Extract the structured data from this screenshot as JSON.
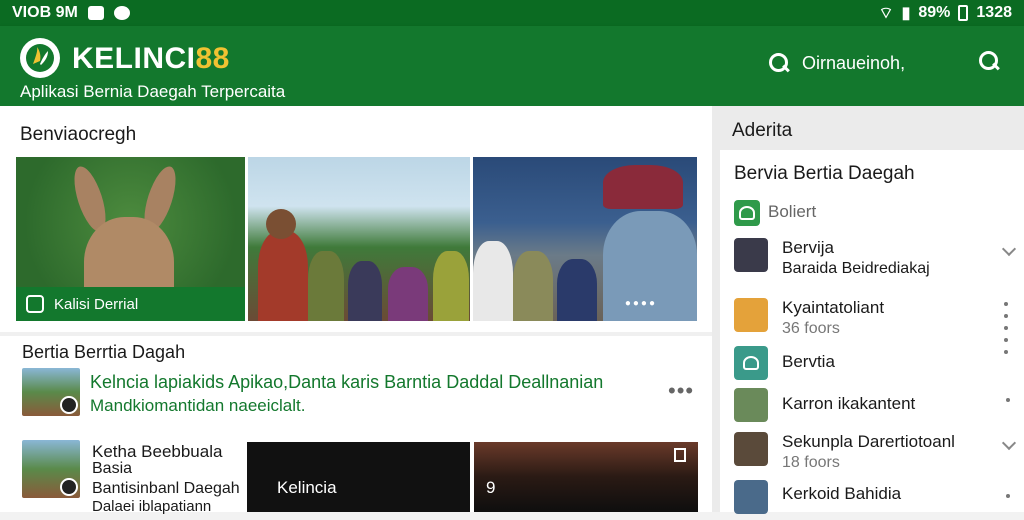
{
  "status_bar": {
    "left_text": "VIOB 9M",
    "battery": "89%",
    "time": "1328"
  },
  "app": {
    "brand_text": "KELINCI",
    "brand_number": "88",
    "tagline": "Aplikasi Bernia Daegah Terpercaita",
    "search_label": "Oirnaueinoh,",
    "accent": "#13782d",
    "brand_gold": "#f1c232"
  },
  "main": {
    "section_title": "Benviaocregh",
    "tile_caption": "Kalisi Derrial",
    "news_header": "Bertia Berrtia Dagah",
    "news1": {
      "title": "Kelncia lapiakids Apikao,Danta karis Barntia Daddal Deallnanian",
      "subtitle": "Mandkiomantidan naeeiclalt."
    },
    "news2": {
      "line1": "Ketha Beebbuala",
      "line2": "Basia",
      "line3": "Bantisinbanl Daegah",
      "line4": "Dalaei iblapatiann"
    },
    "card1_label": "Kelincia",
    "card2_label": "9"
  },
  "sidebar": {
    "header": "Aderita",
    "card_title": "Bervia Bertia Daegah",
    "rows": [
      {
        "title": "Boliert",
        "sub": ""
      },
      {
        "title": "Bervija",
        "sub": "Baraida Beidrediakaj"
      },
      {
        "title": "Kyaintatoliant",
        "sub": "36 foors"
      },
      {
        "title": "Bervtia",
        "sub": ""
      },
      {
        "title": "Karron ikakantent",
        "sub": ""
      },
      {
        "title": "Sekunpla Darertiotoanl",
        "sub": "18 foors"
      },
      {
        "title": "Kerkoid Bahidia",
        "sub": ""
      }
    ]
  }
}
